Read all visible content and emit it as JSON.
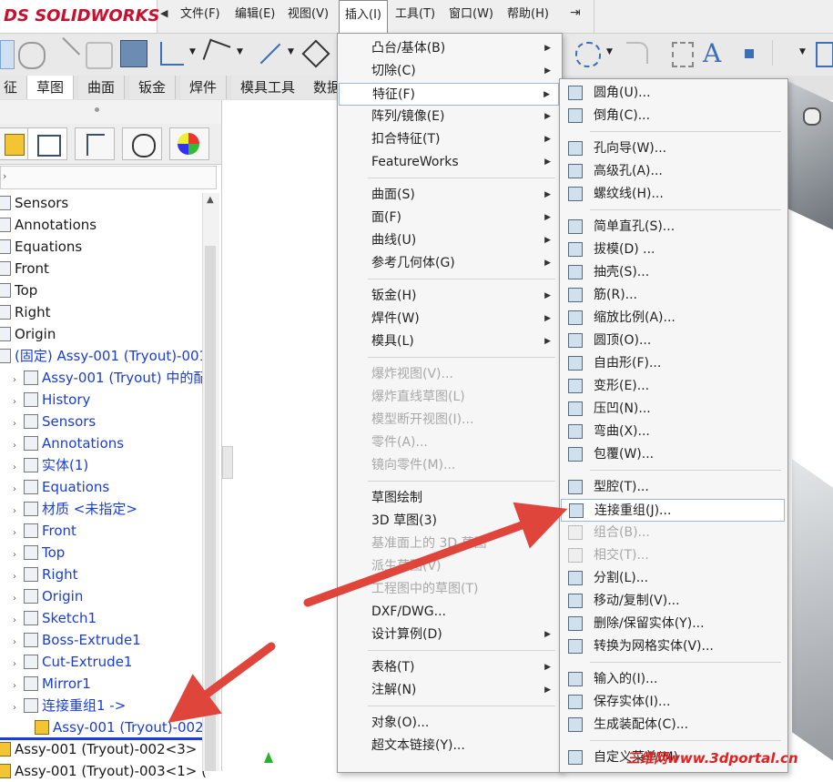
{
  "app": {
    "logo": "SOLIDWORKS",
    "logo_ds": "DS"
  },
  "menubar": [
    {
      "label": "文件(F)"
    },
    {
      "label": "编辑(E)"
    },
    {
      "label": "视图(V)"
    },
    {
      "label": "插入(I)"
    },
    {
      "label": "工具(T)"
    },
    {
      "label": "窗口(W)"
    },
    {
      "label": "帮助(H)"
    }
  ],
  "command_tabs": [
    "征",
    "草图",
    "曲面",
    "钣金",
    "焊件",
    "模具工具",
    "数据"
  ],
  "feature_tree": [
    {
      "label": "Sensors",
      "level": 0,
      "blue": false
    },
    {
      "label": "Annotations",
      "level": 0,
      "blue": false
    },
    {
      "label": "Equations",
      "level": 0,
      "blue": false
    },
    {
      "label": "Front",
      "level": 0,
      "blue": false
    },
    {
      "label": "Top",
      "level": 0,
      "blue": false
    },
    {
      "label": "Right",
      "level": 0,
      "blue": false
    },
    {
      "label": "Origin",
      "level": 0,
      "blue": false
    },
    {
      "label": "(固定) Assy-001 (Tryout)-001",
      "level": 0,
      "blue": true
    },
    {
      "label": "Assy-001 (Tryout) 中的配",
      "level": 1,
      "blue": true
    },
    {
      "label": "History",
      "level": 1,
      "blue": true
    },
    {
      "label": "Sensors",
      "level": 1,
      "blue": true
    },
    {
      "label": "Annotations",
      "level": 1,
      "blue": true
    },
    {
      "label": "实体(1)",
      "level": 1,
      "blue": true
    },
    {
      "label": "Equations",
      "level": 1,
      "blue": true
    },
    {
      "label": "材质 <未指定>",
      "level": 1,
      "blue": true
    },
    {
      "label": "Front",
      "level": 1,
      "blue": true
    },
    {
      "label": "Top",
      "level": 1,
      "blue": true
    },
    {
      "label": "Right",
      "level": 1,
      "blue": true
    },
    {
      "label": "Origin",
      "level": 1,
      "blue": true
    },
    {
      "label": "Sketch1",
      "level": 1,
      "blue": true
    },
    {
      "label": "Boss-Extrude1",
      "level": 1,
      "blue": true
    },
    {
      "label": "Cut-Extrude1",
      "level": 1,
      "blue": true
    },
    {
      "label": "Mirror1",
      "level": 1,
      "blue": true
    },
    {
      "label": "连接重组1 ->",
      "level": 1,
      "blue": true
    },
    {
      "label": "Assy-001 (Tryout)-002",
      "level": 2,
      "blue": true
    },
    {
      "label": "Assy-001 (Tryout)-002<3> (",
      "level": 0,
      "blue": false
    },
    {
      "label": "Assy-001 (Tryout)-003<1> (",
      "level": 0,
      "blue": false
    }
  ],
  "insert_menu": [
    {
      "label": "凸台/基体(B)",
      "sub": true,
      "dis": false
    },
    {
      "label": "切除(C)",
      "sub": true,
      "dis": false
    },
    {
      "label": "特征(F)",
      "sub": true,
      "dis": false,
      "hl": true
    },
    {
      "label": "阵列/镜像(E)",
      "sub": true,
      "dis": false
    },
    {
      "label": "扣合特征(T)",
      "sub": true,
      "dis": false
    },
    {
      "label": "FeatureWorks",
      "sub": true,
      "dis": false
    },
    {
      "label": "曲面(S)",
      "sub": true,
      "dis": false,
      "gap": true
    },
    {
      "label": "面(F)",
      "sub": true,
      "dis": false
    },
    {
      "label": "曲线(U)",
      "sub": true,
      "dis": false
    },
    {
      "label": "参考几何体(G)",
      "sub": true,
      "dis": false
    },
    {
      "label": "钣金(H)",
      "sub": true,
      "dis": false,
      "gap": true
    },
    {
      "label": "焊件(W)",
      "sub": true,
      "dis": false
    },
    {
      "label": "模具(L)",
      "sub": true,
      "dis": false
    },
    {
      "label": "爆炸视图(V)...",
      "sub": false,
      "dis": true,
      "gap": true
    },
    {
      "label": "爆炸直线草图(L)",
      "sub": false,
      "dis": true
    },
    {
      "label": "模型断开视图(I)...",
      "sub": false,
      "dis": true
    },
    {
      "label": "零件(A)...",
      "sub": false,
      "dis": true
    },
    {
      "label": "镜向零件(M)...",
      "sub": false,
      "dis": true
    },
    {
      "label": "草图绘制",
      "sub": false,
      "dis": false,
      "gap": true
    },
    {
      "label": "3D 草图(3)",
      "sub": false,
      "dis": false
    },
    {
      "label": "基准面上的 3D 草图",
      "sub": false,
      "dis": true
    },
    {
      "label": "派生草图(V)",
      "sub": false,
      "dis": true
    },
    {
      "label": "工程图中的草图(T)",
      "sub": false,
      "dis": true
    },
    {
      "label": "DXF/DWG...",
      "sub": false,
      "dis": false
    },
    {
      "label": "设计算例(D)",
      "sub": true,
      "dis": false
    },
    {
      "label": "表格(T)",
      "sub": true,
      "dis": false,
      "gap": true
    },
    {
      "label": "注解(N)",
      "sub": true,
      "dis": false
    },
    {
      "label": "对象(O)...",
      "sub": false,
      "dis": false,
      "gap": true
    },
    {
      "label": "超文本链接(Y)...",
      "sub": false,
      "dis": false
    }
  ],
  "feature_submenu": [
    {
      "label": "圆角(U)...",
      "dis": false
    },
    {
      "label": "倒角(C)...",
      "dis": false
    },
    {
      "label": "孔向导(W)...",
      "dis": false,
      "gap": true
    },
    {
      "label": "高级孔(A)...",
      "dis": false
    },
    {
      "label": "螺纹线(H)...",
      "dis": false
    },
    {
      "label": "简单直孔(S)...",
      "dis": false,
      "gap": true
    },
    {
      "label": "拔模(D) ...",
      "dis": false
    },
    {
      "label": "抽壳(S)...",
      "dis": false
    },
    {
      "label": "筋(R)...",
      "dis": false
    },
    {
      "label": "缩放比例(A)...",
      "dis": false
    },
    {
      "label": "圆顶(O)...",
      "dis": false
    },
    {
      "label": "自由形(F)...",
      "dis": false
    },
    {
      "label": "变形(E)...",
      "dis": false
    },
    {
      "label": "压凹(N)...",
      "dis": false
    },
    {
      "label": "弯曲(X)...",
      "dis": false
    },
    {
      "label": "包覆(W)...",
      "dis": false
    },
    {
      "label": "型腔(T)...",
      "dis": false,
      "gap": true
    },
    {
      "label": "连接重组(J)...",
      "dis": false,
      "hl": true
    },
    {
      "label": "组合(B)...",
      "dis": true
    },
    {
      "label": "相交(T)...",
      "dis": true
    },
    {
      "label": "分割(L)...",
      "dis": false
    },
    {
      "label": "移动/复制(V)...",
      "dis": false
    },
    {
      "label": "删除/保留实体(Y)...",
      "dis": false
    },
    {
      "label": "转换为网格实体(V)...",
      "dis": false
    },
    {
      "label": "输入的(I)...",
      "dis": false,
      "gap": true
    },
    {
      "label": "保存实体(I)...",
      "dis": false
    },
    {
      "label": "生成装配体(C)...",
      "dis": false
    },
    {
      "label": "自定义菜单(M)",
      "dis": false,
      "gap": true
    }
  ],
  "watermark": "三维网www.3dportal.cn",
  "colors": {
    "accent": "#1a3dd8",
    "arrow": "#e0453c",
    "logo": "#c8102e"
  }
}
